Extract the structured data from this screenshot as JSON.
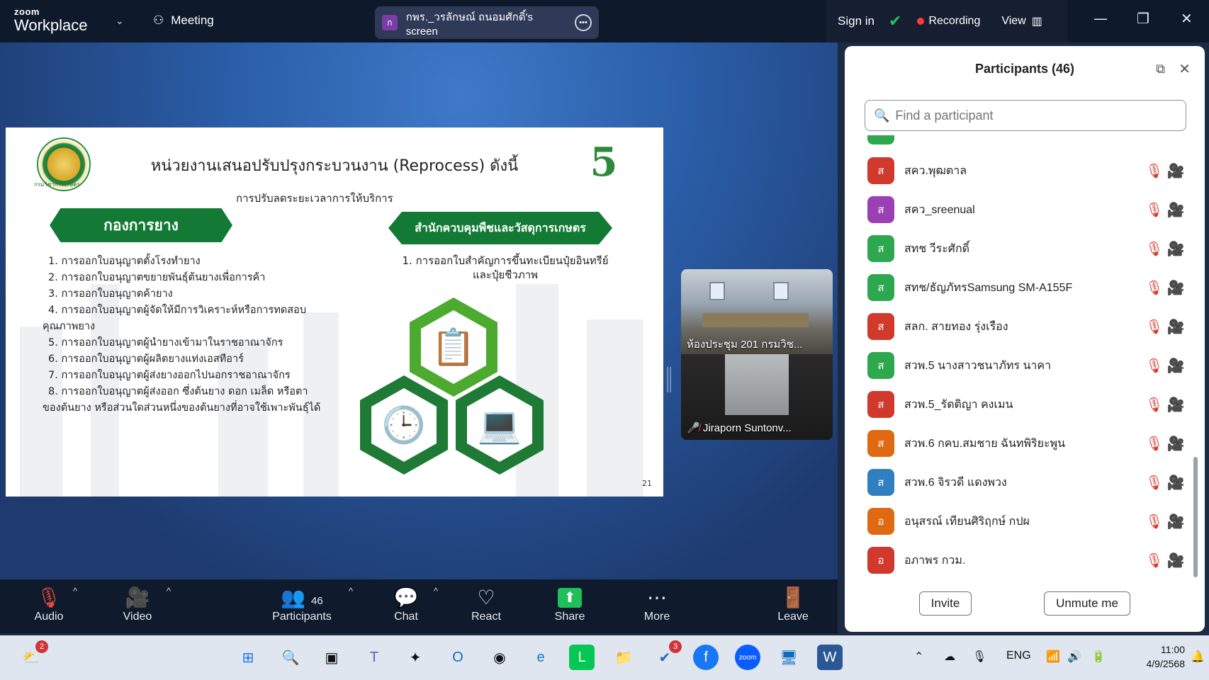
{
  "app": {
    "brand_small": "zoom",
    "brand_big": "Workplace",
    "meeting_label": "Meeting"
  },
  "share_pill": {
    "avatar": "ก",
    "label": "กพร._วรลักษณ์ ถนอมศักดิ์'s screen"
  },
  "topbar": {
    "sign_in": "Sign in",
    "recording": "Recording",
    "view": "View"
  },
  "slide": {
    "title": "หน่วยงานเสนอปรับปรุงกระบวนงาน (Reprocess) ดังนี้",
    "subtitle": "การปรับลดระยะเวลาการให้บริการ",
    "banner_left": "กองการยาง",
    "banner_right": "สำนักควบคุมพืชและวัสดุการเกษตร",
    "left_items": [
      "1. การออกใบอนุญาตตั้งโรงทำยาง",
      "2. การออกใบอนุญาตขยายพันธุ์ต้นยางเพื่อการค้า",
      "3. การออกใบอนุญาตค้ายาง",
      "4. การออกใบอนุญาตผู้จัดให้มีการวิเคราะห์หรือการทดสอบ",
      "คุณภาพยาง",
      "5. การออกใบอนุญาตผู้นำยางเข้ามาในราชอาณาจักร",
      "6. การออกใบอนุญาตผู้ผลิตยางแท่งเอสทีอาร์",
      "7. การออกใบอนุญาตผู้ส่งยางออกไปนอกราชอาณาจักร",
      "8. การออกใบอนุญาตผู้ส่งออก ซึ่งต้นยาง ดอก เมล็ด หรือตา",
      "ของต้นยาง หรือส่วนใดส่วนหนึ่งของต้นยางที่อาจใช้เพาะพันธุ์ได้"
    ],
    "right_item_line1": "1. การออกใบสำคัญการขึ้นทะเบียนปุ๋ยอินทรีย์",
    "right_item_line2": "และปุ๋ยชีวภาพ",
    "seal_caption": "กรมวิชาการเกษตร",
    "logo_text": "5",
    "page_number": "21"
  },
  "video_tiles": [
    {
      "label": "ห้องประชุม 201 กรมวิช..."
    },
    {
      "label": "Jiraporn Suntonv..."
    }
  ],
  "toolbar": {
    "audio": "Audio",
    "video": "Video",
    "participants": "Participants",
    "participants_count": "46",
    "chat": "Chat",
    "react": "React",
    "share": "Share",
    "more": "More",
    "leave": "Leave"
  },
  "panel": {
    "title": "Participants (46)",
    "search_placeholder": "Find a participant",
    "participants": [
      {
        "initial": "ส",
        "name": "สคว.พุฒตาล",
        "color": "#d0392b"
      },
      {
        "initial": "ส",
        "name": "สคว_sreenual",
        "color": "#9b3fb5"
      },
      {
        "initial": "ส",
        "name": "สทช วีระศักดิ์",
        "color": "#2ea84f"
      },
      {
        "initial": "ส",
        "name": "สทช/ธัญภัทรSamsung SM-A155F",
        "color": "#2ea84f"
      },
      {
        "initial": "ส",
        "name": "สลก. สายทอง รุ่งเรือง",
        "color": "#d0392b"
      },
      {
        "initial": "ส",
        "name": "สวพ.5 นางสาวชนาภัทร นาคา",
        "color": "#2ea84f"
      },
      {
        "initial": "ส",
        "name": "สวพ.5_รัตติญา คงเมน",
        "color": "#d0392b"
      },
      {
        "initial": "ส",
        "name": "สวพ.6 กคบ.สมชาย ฉันทพิริยะพูน",
        "color": "#e06a12"
      },
      {
        "initial": "ส",
        "name": "สวพ.6 จิรวดี แดงพวง",
        "color": "#2f7fc1"
      },
      {
        "initial": "อ",
        "name": "อนุสรณ์ เทียนศิริฤกษ์ กปผ",
        "color": "#e06a12"
      },
      {
        "initial": "อ",
        "name": "อภาพร กวม.",
        "color": "#d0392b"
      }
    ],
    "invite": "Invite",
    "unmute": "Unmute me"
  },
  "taskbar": {
    "weather_badge": "2",
    "todo_badge": "3",
    "language": "ENG",
    "time": "11:00",
    "date": "4/9/2568"
  }
}
